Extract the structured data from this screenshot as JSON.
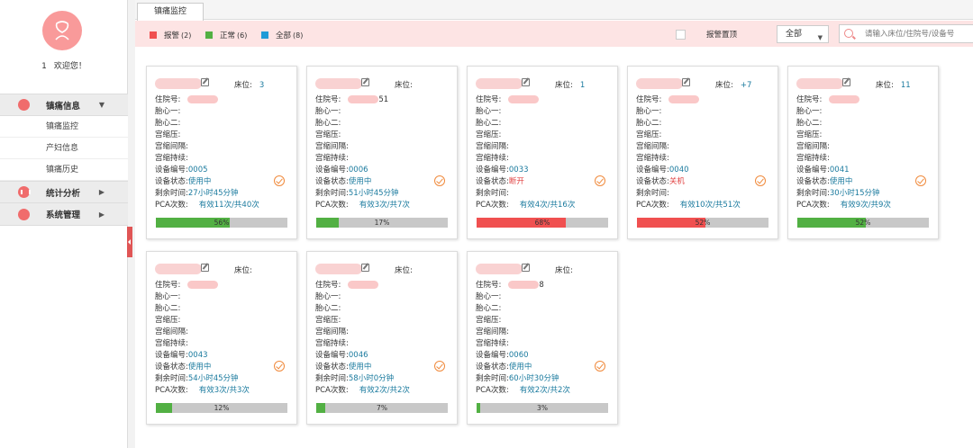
{
  "user": {
    "id": "1",
    "welcome": "欢迎您！"
  },
  "nav": {
    "sections": [
      {
        "label": "镇痛信息",
        "icon": "drop-icon",
        "arrow": "▼"
      },
      {
        "label": "统计分析",
        "icon": "bar-chart-icon",
        "arrow": "▶"
      },
      {
        "label": "系统管理",
        "icon": "hospital-icon",
        "arrow": "▶"
      }
    ],
    "sub_items": [
      "镇痛监控",
      "产妇信息",
      "镇痛历史"
    ]
  },
  "tabs": [
    {
      "label": "镇痛监控"
    }
  ],
  "toolbar": {
    "legend": [
      {
        "label": "报警",
        "count": "(2)",
        "color": "#f05050"
      },
      {
        "label": "正常",
        "count": "(6)",
        "color": "#52b043"
      },
      {
        "label": "全部",
        "count": "(8)",
        "color": "#1e9bd7"
      }
    ],
    "alarm_top_label": "报警置顶",
    "select_value": "全部",
    "search_placeholder": "请输入床位/住院号/设备号"
  },
  "colors": {
    "normal": "#52b043",
    "alarm": "#f05050",
    "value": "#1a7a9e",
    "check": "#f08a3c"
  },
  "field_labels": {
    "bed": "床位:",
    "inpatient": "住院号:",
    "fhr1": "胎心一:",
    "fhr2": "胎心二:",
    "contraction_pressure": "宫缩压:",
    "contraction_interval": "宫缩间隔:",
    "contraction_duration": "宫缩持续:",
    "device_no": "设备编号:",
    "device_status": "设备状态:",
    "remaining": "剩余时间:",
    "pca": "PCA次数:"
  },
  "cards": [
    {
      "bed": "3",
      "inpatient_suffix": "",
      "device": "0005",
      "status": "使用中",
      "status_alarm": false,
      "remaining": "27小时45分钟",
      "pca": "有效11次/共40次",
      "progress_label": "56%",
      "progress": 56,
      "alarm": false
    },
    {
      "bed": "",
      "inpatient_suffix": "51",
      "device": "0006",
      "status": "使用中",
      "status_alarm": false,
      "remaining": "51小时45分钟",
      "pca": "有效3次/共7次",
      "progress_label": "17%",
      "progress": 17,
      "alarm": false
    },
    {
      "bed": "1",
      "inpatient_suffix": "",
      "device": "0033",
      "status": "断开",
      "status_alarm": true,
      "remaining": "",
      "pca": "有效4次/共16次",
      "progress_label": "68%",
      "progress": 68,
      "alarm": true
    },
    {
      "bed": "+7",
      "inpatient_suffix": "",
      "device": "0040",
      "status": "关机",
      "status_alarm": true,
      "remaining": "",
      "pca": "有效10次/共51次",
      "progress_label": "52%",
      "progress": 52,
      "alarm": true
    },
    {
      "bed": "11",
      "inpatient_suffix": "",
      "device": "0041",
      "status": "使用中",
      "status_alarm": false,
      "remaining": "30小时15分钟",
      "pca": "有效9次/共9次",
      "progress_label": "52%",
      "progress": 52,
      "alarm": false
    },
    {
      "bed": "",
      "inpatient_suffix": "",
      "device": "0043",
      "status": "使用中",
      "status_alarm": false,
      "remaining": "54小时45分钟",
      "pca": "有效3次/共3次",
      "progress_label": "12%",
      "progress": 12,
      "alarm": false
    },
    {
      "bed": "",
      "inpatient_suffix": "",
      "device": "0046",
      "status": "使用中",
      "status_alarm": false,
      "remaining": "58小时0分钟",
      "pca": "有效2次/共2次",
      "progress_label": "7%",
      "progress": 7,
      "alarm": false
    },
    {
      "bed": "",
      "inpatient_suffix": "8",
      "device": "0060",
      "status": "使用中",
      "status_alarm": false,
      "remaining": "60小时30分钟",
      "pca": "有效2次/共2次",
      "progress_label": "3%",
      "progress": 3,
      "alarm": false
    }
  ]
}
